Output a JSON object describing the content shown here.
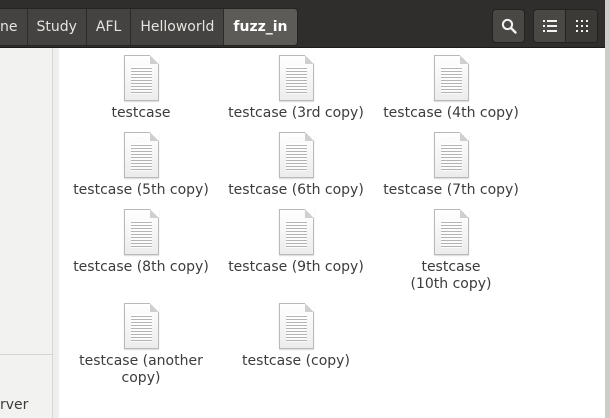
{
  "breadcrumbs": [
    {
      "label": "ne"
    },
    {
      "label": "Study"
    },
    {
      "label": "AFL"
    },
    {
      "label": "Helloworld"
    },
    {
      "label": "fuzz_in",
      "active": true
    }
  ],
  "toolbar": {
    "search_icon": "search-icon",
    "list_view_icon": "list-view-icon",
    "grid_view_icon": "grid-view-icon"
  },
  "sidebar": {
    "partial_label": "rver"
  },
  "files": [
    {
      "name": "testcase",
      "icon": "text-file-icon"
    },
    {
      "name": "testcase (3rd copy)",
      "icon": "text-file-icon"
    },
    {
      "name": "testcase (4th copy)",
      "icon": "text-file-icon"
    },
    {
      "name": "testcase (5th copy)",
      "icon": "text-file-icon"
    },
    {
      "name": "testcase (6th copy)",
      "icon": "text-file-icon"
    },
    {
      "name": "testcase (7th copy)",
      "icon": "text-file-icon"
    },
    {
      "name": "testcase (8th copy)",
      "icon": "text-file-icon"
    },
    {
      "name": "testcase (9th copy)",
      "icon": "text-file-icon"
    },
    {
      "name": "testcase (10th copy)",
      "icon": "text-file-icon"
    },
    {
      "name": "testcase (another copy)",
      "icon": "text-file-icon"
    },
    {
      "name": "testcase (copy)",
      "icon": "text-file-icon"
    }
  ],
  "colors": {
    "header": "#2f2e2c",
    "breadcrumb_active": "#5d5b57",
    "file_label": "#3c3c3c"
  }
}
